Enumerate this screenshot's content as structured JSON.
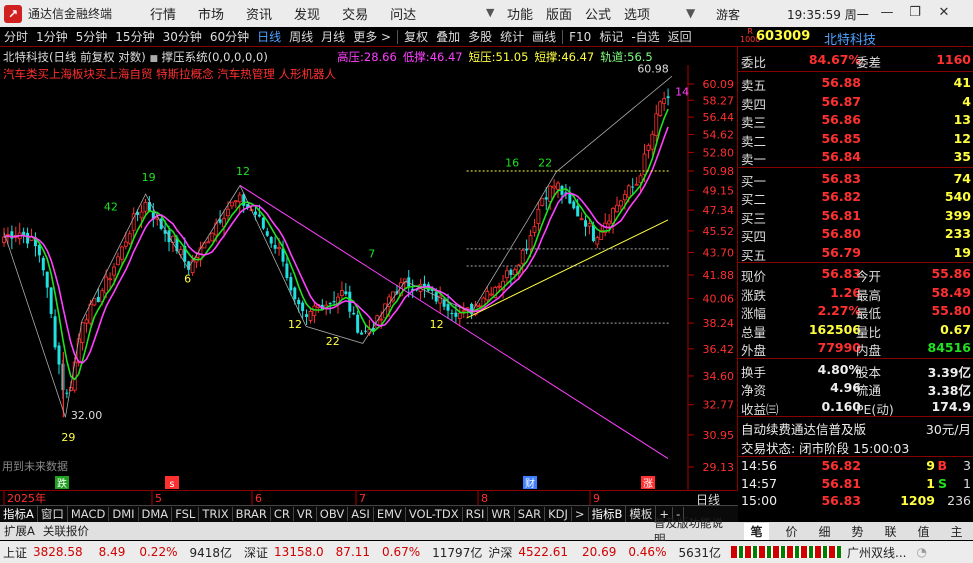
{
  "titlebar": {
    "app_title": "通达信金融终端",
    "menus": [
      "行情",
      "市场",
      "资讯",
      "发现",
      "交易",
      "问达"
    ],
    "menus2": [
      "功能",
      "版面",
      "公式",
      "选项"
    ],
    "guest": "游客",
    "clock": "19:35:59 周一",
    "minimize": "—",
    "restore": "❐",
    "close": "✕"
  },
  "toolbar": {
    "items": [
      "分时",
      "1分钟",
      "5分钟",
      "15分钟",
      "30分钟",
      "60分钟",
      "日线",
      "周线",
      "月线",
      "更多 >",
      "复权",
      "叠加",
      "多股",
      "统计",
      "画线",
      "F10",
      "标记",
      "-自选",
      "返回"
    ],
    "active": "日线"
  },
  "stock": {
    "name": "北特科技",
    "code": "603009",
    "chart_info": "北特科技(日线 前复权 对数)",
    "indicator": "撑压系统(0,0,0,0,0)",
    "press_labels": [
      {
        "label": "高压:",
        "value": "28.66",
        "color": "#ff40ff"
      },
      {
        "label": "低撑:",
        "value": "46.47",
        "color": "#ff40ff"
      },
      {
        "label": "短压:",
        "value": "51.05",
        "color": "#ffff40"
      },
      {
        "label": "短撑:",
        "value": "46.47",
        "color": "#ffff40"
      },
      {
        "label": "轨道:",
        "value": "56.5",
        "color": "#80ff80"
      }
    ],
    "concepts": "汽车类买上海板块买上海自贸 特斯拉概念 汽车热管理 人形机器人",
    "future_label": "用到未来数据"
  },
  "chart_data": {
    "type": "candlestick",
    "y_ticks": [
      "60.09",
      "58.27",
      "56.44",
      "54.62",
      "52.80",
      "50.98",
      "49.15",
      "47.34",
      "45.52",
      "43.70",
      "41.88",
      "40.06",
      "38.24",
      "36.42",
      "34.60",
      "32.77",
      "30.95",
      "29.13"
    ],
    "x_labels": [
      "2025年",
      "5",
      "6",
      "7",
      "8",
      "9"
    ],
    "annotations": [
      {
        "text": "29",
        "color": "#ffff40"
      },
      {
        "text": "32.00",
        "color": "#ddd"
      },
      {
        "text": "12",
        "color": "#ffff40"
      },
      {
        "text": "22",
        "color": "#ffff40"
      },
      {
        "text": "12",
        "color": "#ffff40"
      },
      {
        "text": "6",
        "color": "#ffff40"
      },
      {
        "text": "19",
        "color": "#20e020"
      },
      {
        "text": "42",
        "color": "#20e020"
      },
      {
        "text": "12",
        "color": "#20e020"
      },
      {
        "text": "7",
        "color": "#20e020"
      },
      {
        "text": "16",
        "color": "#20e020"
      },
      {
        "text": "22",
        "color": "#20e020"
      },
      {
        "text": "60.98",
        "color": "#ddd"
      },
      {
        "text": "14",
        "color": "#ff40ff"
      }
    ],
    "event_badges": [
      {
        "text": "跌",
        "color": "#20a020"
      },
      {
        "text": "s",
        "color": "#ff3030"
      },
      {
        "text": "财",
        "color": "#4080ff"
      },
      {
        "text": "涨",
        "color": "#ff3030"
      }
    ]
  },
  "indicator_tabs": [
    "指标A",
    "窗口",
    "MACD",
    "DMI",
    "DMA",
    "FSL",
    "TRIX",
    "BRAR",
    "CR",
    "VR",
    "OBV",
    "ASI",
    "EMV",
    "VOL-TDX",
    "RSI",
    "WR",
    "SAR",
    "KDJ",
    ">",
    "指标B",
    "模板",
    "+",
    "-"
  ],
  "ext_tabs": [
    "扩展A",
    "关联报价"
  ],
  "ext_right": "普及版功能说明",
  "right_tabs": [
    "笔",
    "价",
    "细",
    "势",
    "联",
    "值",
    "主"
  ],
  "quote": {
    "weibi_label": "委比",
    "weibi": "84.67%",
    "weicha_label": "委差",
    "weicha": "1160",
    "asks": [
      {
        "label": "卖五",
        "price": "56.88",
        "vol": "41"
      },
      {
        "label": "卖四",
        "price": "56.87",
        "vol": "4"
      },
      {
        "label": "卖三",
        "price": "56.86",
        "vol": "13"
      },
      {
        "label": "卖二",
        "price": "56.85",
        "vol": "12"
      },
      {
        "label": "卖一",
        "price": "56.84",
        "vol": "35"
      }
    ],
    "bids": [
      {
        "label": "买一",
        "price": "56.83",
        "vol": "74"
      },
      {
        "label": "买二",
        "price": "56.82",
        "vol": "540"
      },
      {
        "label": "买三",
        "price": "56.81",
        "vol": "399"
      },
      {
        "label": "买四",
        "price": "56.80",
        "vol": "233"
      },
      {
        "label": "买五",
        "price": "56.79",
        "vol": "19"
      }
    ],
    "stats": [
      {
        "l1": "现价",
        "v1": "56.83",
        "c1": "#ff3030",
        "l2": "今开",
        "v2": "55.86",
        "c2": "#ff3030"
      },
      {
        "l1": "涨跌",
        "v1": "1.26",
        "c1": "#ff3030",
        "l2": "最高",
        "v2": "58.49",
        "c2": "#ff3030"
      },
      {
        "l1": "涨幅",
        "v1": "2.27%",
        "c1": "#ff3030",
        "l2": "最低",
        "v2": "55.80",
        "c2": "#ff3030"
      },
      {
        "l1": "总量",
        "v1": "162506",
        "c1": "#ffff40",
        "l2": "量比",
        "v2": "0.67",
        "c2": "#ffff40"
      },
      {
        "l1": "外盘",
        "v1": "77990",
        "c1": "#ff3030",
        "l2": "内盘",
        "v2": "84516",
        "c2": "#20e020"
      }
    ],
    "stats2": [
      {
        "l1": "换手",
        "v1": "4.80%",
        "l2": "股本",
        "v2": "3.39亿"
      },
      {
        "l1": "净资",
        "v1": "4.96",
        "l2": "流通",
        "v2": "3.38亿"
      },
      {
        "l1": "收益㈢",
        "v1": "0.160",
        "l2": "PE(动)",
        "v2": "174.9"
      }
    ],
    "fee_line": "自动续费通达信普及版",
    "fee_price": "30元/月",
    "trade_state": "交易状态: 闭市阶段 15:00:03",
    "ticks": [
      {
        "time": "14:56",
        "price": "56.82",
        "vol": "9",
        "bs": "B",
        "n": "3",
        "bsc": "#ff3030"
      },
      {
        "time": "14:57",
        "price": "56.81",
        "vol": "1",
        "bs": "S",
        "n": "1",
        "bsc": "#20e020"
      },
      {
        "time": "15:00",
        "price": "56.83",
        "vol": "1209",
        "bs": "",
        "n": "236",
        "bsc": "#ff3030"
      }
    ]
  },
  "statusbar": {
    "sh_label": "上证",
    "sh_val": "3828.58",
    "sh_chg": "8.49",
    "sh_pct": "0.22%",
    "sh_amt": "9418亿",
    "sz_label": "深证",
    "sz_val": "13158.0",
    "sz_chg": "87.11",
    "sz_pct": "0.67%",
    "sz_amt": "11797亿",
    "hs_label": "沪深",
    "hs_val": "4522.61",
    "hs_chg": "20.69",
    "hs_pct": "0.46%",
    "hs_amt": "5631亿",
    "region": "广州双线..."
  },
  "colors": {
    "up": "#ff3030",
    "down": "#20e0e0",
    "ma_green": "#20e020",
    "ma_magenta": "#ff40ff",
    "support": "#ffff40",
    "grid_red": "#800000"
  }
}
